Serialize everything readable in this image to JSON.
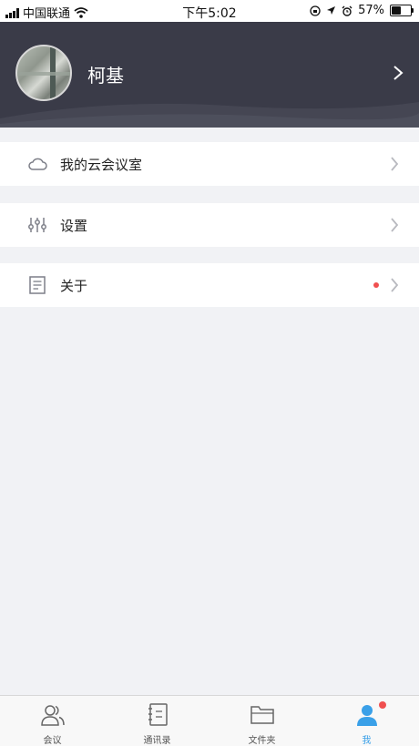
{
  "status_bar": {
    "carrier": "中国联通",
    "time": "下午5:02",
    "battery_percent": "57%",
    "battery_level": 0.57
  },
  "profile": {
    "name": "柯基"
  },
  "menu": {
    "items": [
      {
        "label": "我的云会议室",
        "icon": "cloud-icon",
        "badge": false
      },
      {
        "label": "设置",
        "icon": "sliders-icon",
        "badge": false
      },
      {
        "label": "关于",
        "icon": "document-icon",
        "badge": true
      }
    ]
  },
  "tabbar": {
    "tabs": [
      {
        "label": "会议",
        "icon": "users-icon",
        "active": false
      },
      {
        "label": "通讯录",
        "icon": "contacts-book-icon",
        "active": false
      },
      {
        "label": "文件夹",
        "icon": "folder-icon",
        "active": false
      },
      {
        "label": "我",
        "icon": "person-icon",
        "active": true,
        "badge": true
      }
    ]
  },
  "colors": {
    "header_bg": "#3a3b48",
    "page_bg": "#f1f2f5",
    "accent": "#3aa0e8",
    "badge": "#f05050"
  }
}
